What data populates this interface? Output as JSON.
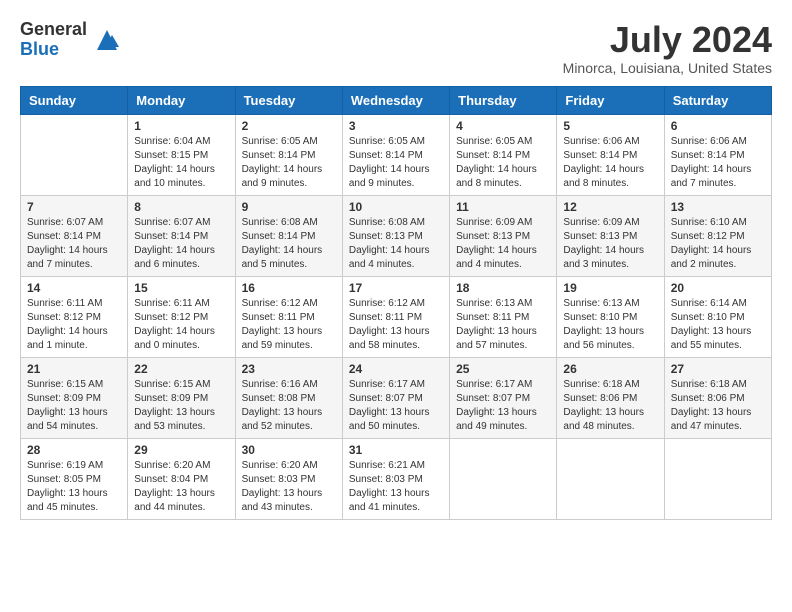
{
  "header": {
    "logo_general": "General",
    "logo_blue": "Blue",
    "month_year": "July 2024",
    "location": "Minorca, Louisiana, United States"
  },
  "weekdays": [
    "Sunday",
    "Monday",
    "Tuesday",
    "Wednesday",
    "Thursday",
    "Friday",
    "Saturday"
  ],
  "weeks": [
    [
      {
        "day": "",
        "info": ""
      },
      {
        "day": "1",
        "info": "Sunrise: 6:04 AM\nSunset: 8:15 PM\nDaylight: 14 hours\nand 10 minutes."
      },
      {
        "day": "2",
        "info": "Sunrise: 6:05 AM\nSunset: 8:14 PM\nDaylight: 14 hours\nand 9 minutes."
      },
      {
        "day": "3",
        "info": "Sunrise: 6:05 AM\nSunset: 8:14 PM\nDaylight: 14 hours\nand 9 minutes."
      },
      {
        "day": "4",
        "info": "Sunrise: 6:05 AM\nSunset: 8:14 PM\nDaylight: 14 hours\nand 8 minutes."
      },
      {
        "day": "5",
        "info": "Sunrise: 6:06 AM\nSunset: 8:14 PM\nDaylight: 14 hours\nand 8 minutes."
      },
      {
        "day": "6",
        "info": "Sunrise: 6:06 AM\nSunset: 8:14 PM\nDaylight: 14 hours\nand 7 minutes."
      }
    ],
    [
      {
        "day": "7",
        "info": "Sunrise: 6:07 AM\nSunset: 8:14 PM\nDaylight: 14 hours\nand 7 minutes."
      },
      {
        "day": "8",
        "info": "Sunrise: 6:07 AM\nSunset: 8:14 PM\nDaylight: 14 hours\nand 6 minutes."
      },
      {
        "day": "9",
        "info": "Sunrise: 6:08 AM\nSunset: 8:14 PM\nDaylight: 14 hours\nand 5 minutes."
      },
      {
        "day": "10",
        "info": "Sunrise: 6:08 AM\nSunset: 8:13 PM\nDaylight: 14 hours\nand 4 minutes."
      },
      {
        "day": "11",
        "info": "Sunrise: 6:09 AM\nSunset: 8:13 PM\nDaylight: 14 hours\nand 4 minutes."
      },
      {
        "day": "12",
        "info": "Sunrise: 6:09 AM\nSunset: 8:13 PM\nDaylight: 14 hours\nand 3 minutes."
      },
      {
        "day": "13",
        "info": "Sunrise: 6:10 AM\nSunset: 8:12 PM\nDaylight: 14 hours\nand 2 minutes."
      }
    ],
    [
      {
        "day": "14",
        "info": "Sunrise: 6:11 AM\nSunset: 8:12 PM\nDaylight: 14 hours\nand 1 minute."
      },
      {
        "day": "15",
        "info": "Sunrise: 6:11 AM\nSunset: 8:12 PM\nDaylight: 14 hours\nand 0 minutes."
      },
      {
        "day": "16",
        "info": "Sunrise: 6:12 AM\nSunset: 8:11 PM\nDaylight: 13 hours\nand 59 minutes."
      },
      {
        "day": "17",
        "info": "Sunrise: 6:12 AM\nSunset: 8:11 PM\nDaylight: 13 hours\nand 58 minutes."
      },
      {
        "day": "18",
        "info": "Sunrise: 6:13 AM\nSunset: 8:11 PM\nDaylight: 13 hours\nand 57 minutes."
      },
      {
        "day": "19",
        "info": "Sunrise: 6:13 AM\nSunset: 8:10 PM\nDaylight: 13 hours\nand 56 minutes."
      },
      {
        "day": "20",
        "info": "Sunrise: 6:14 AM\nSunset: 8:10 PM\nDaylight: 13 hours\nand 55 minutes."
      }
    ],
    [
      {
        "day": "21",
        "info": "Sunrise: 6:15 AM\nSunset: 8:09 PM\nDaylight: 13 hours\nand 54 minutes."
      },
      {
        "day": "22",
        "info": "Sunrise: 6:15 AM\nSunset: 8:09 PM\nDaylight: 13 hours\nand 53 minutes."
      },
      {
        "day": "23",
        "info": "Sunrise: 6:16 AM\nSunset: 8:08 PM\nDaylight: 13 hours\nand 52 minutes."
      },
      {
        "day": "24",
        "info": "Sunrise: 6:17 AM\nSunset: 8:07 PM\nDaylight: 13 hours\nand 50 minutes."
      },
      {
        "day": "25",
        "info": "Sunrise: 6:17 AM\nSunset: 8:07 PM\nDaylight: 13 hours\nand 49 minutes."
      },
      {
        "day": "26",
        "info": "Sunrise: 6:18 AM\nSunset: 8:06 PM\nDaylight: 13 hours\nand 48 minutes."
      },
      {
        "day": "27",
        "info": "Sunrise: 6:18 AM\nSunset: 8:06 PM\nDaylight: 13 hours\nand 47 minutes."
      }
    ],
    [
      {
        "day": "28",
        "info": "Sunrise: 6:19 AM\nSunset: 8:05 PM\nDaylight: 13 hours\nand 45 minutes."
      },
      {
        "day": "29",
        "info": "Sunrise: 6:20 AM\nSunset: 8:04 PM\nDaylight: 13 hours\nand 44 minutes."
      },
      {
        "day": "30",
        "info": "Sunrise: 6:20 AM\nSunset: 8:03 PM\nDaylight: 13 hours\nand 43 minutes."
      },
      {
        "day": "31",
        "info": "Sunrise: 6:21 AM\nSunset: 8:03 PM\nDaylight: 13 hours\nand 41 minutes."
      },
      {
        "day": "",
        "info": ""
      },
      {
        "day": "",
        "info": ""
      },
      {
        "day": "",
        "info": ""
      }
    ]
  ]
}
